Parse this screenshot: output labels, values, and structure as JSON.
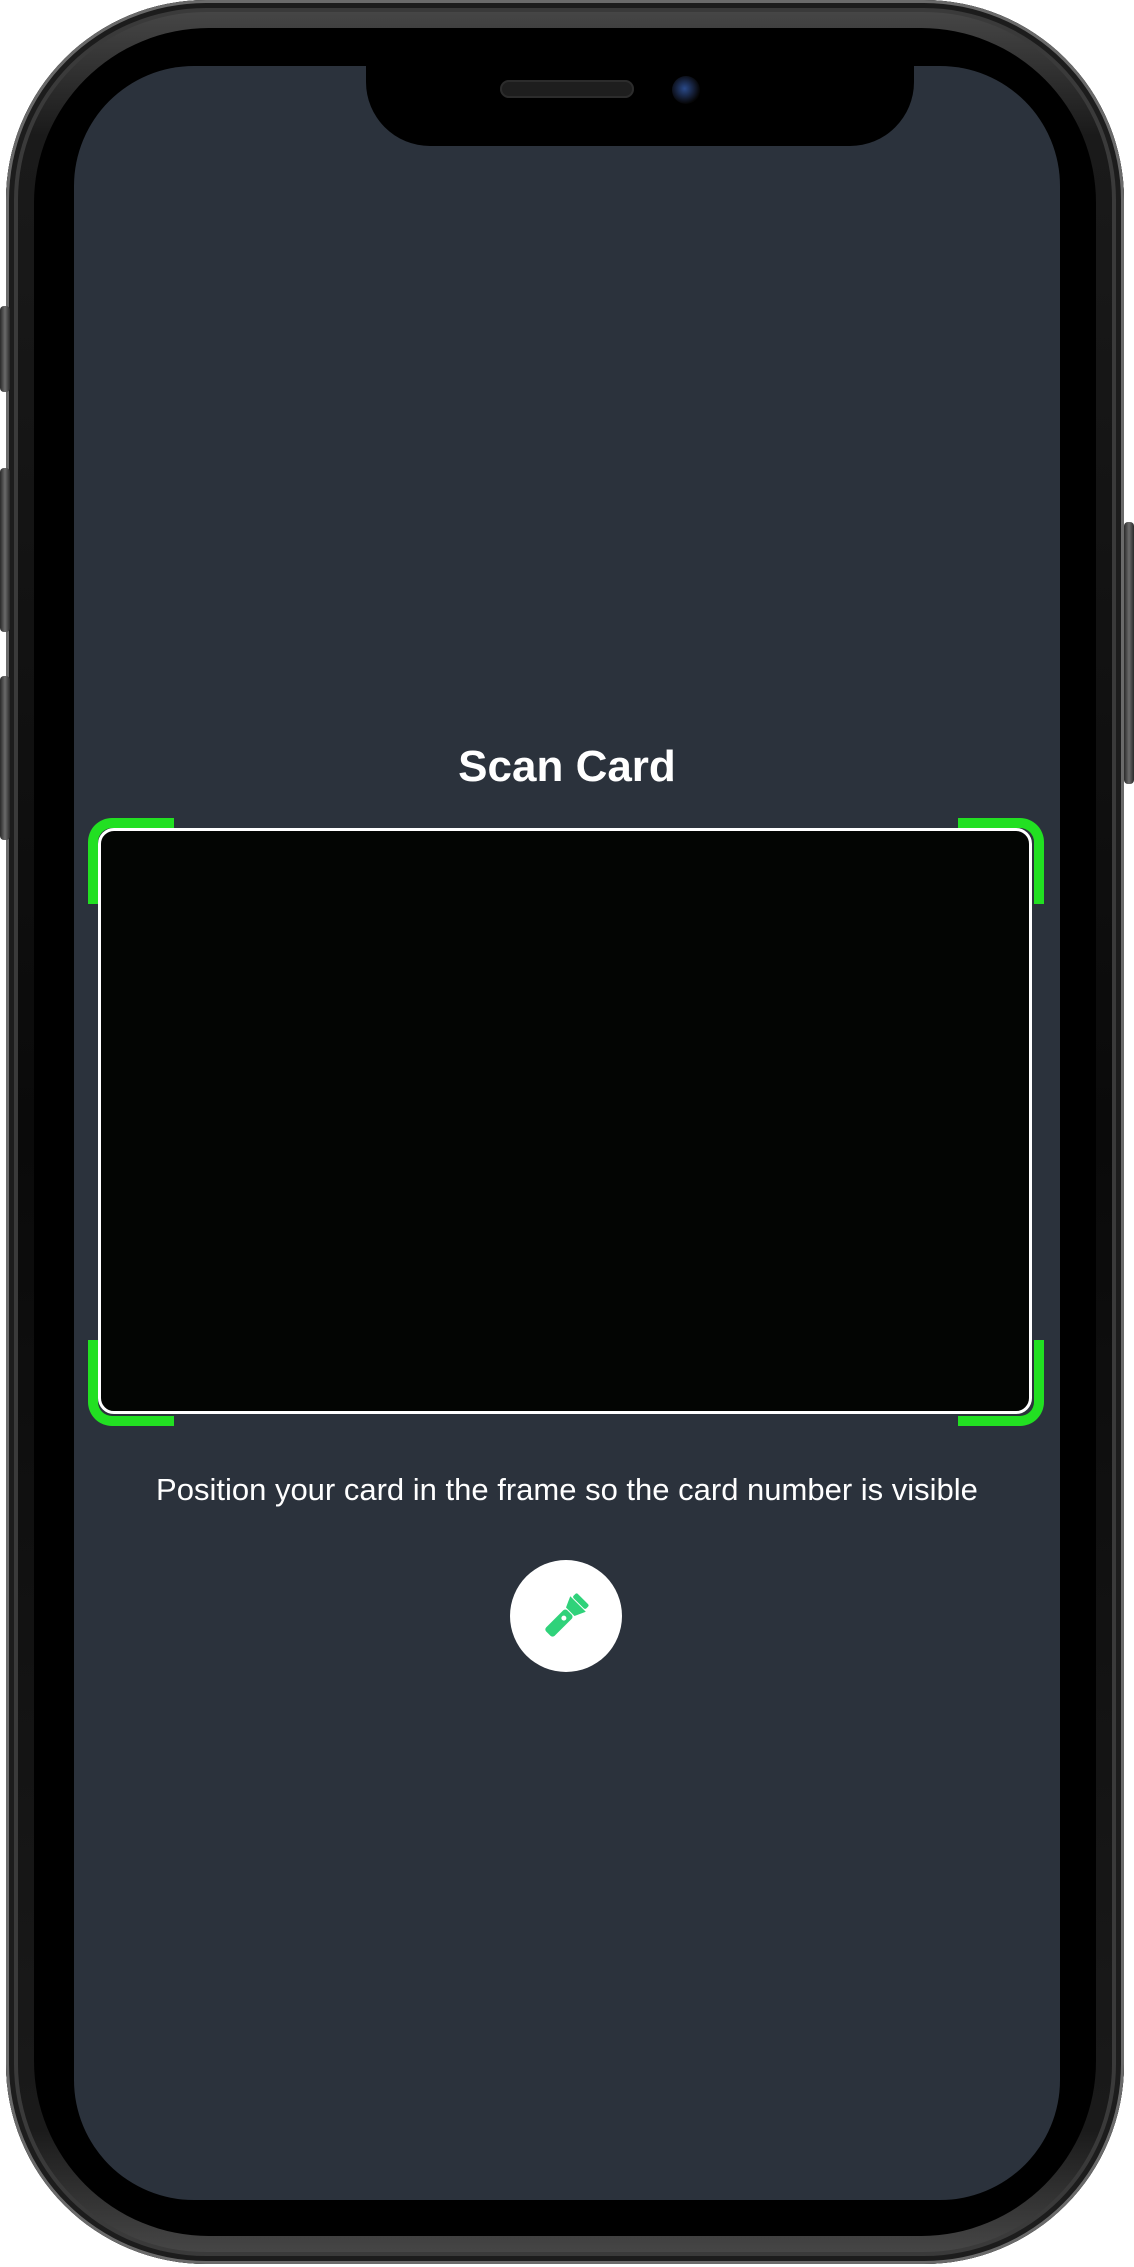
{
  "screen": {
    "title": "Scan Card",
    "hint": "Position your card in the frame so the card number is visible",
    "torch_button_icon": "flashlight-icon"
  },
  "colors": {
    "background": "#2b323c",
    "frame_corner": "#22e022",
    "torch_icon": "#2fd27a"
  }
}
